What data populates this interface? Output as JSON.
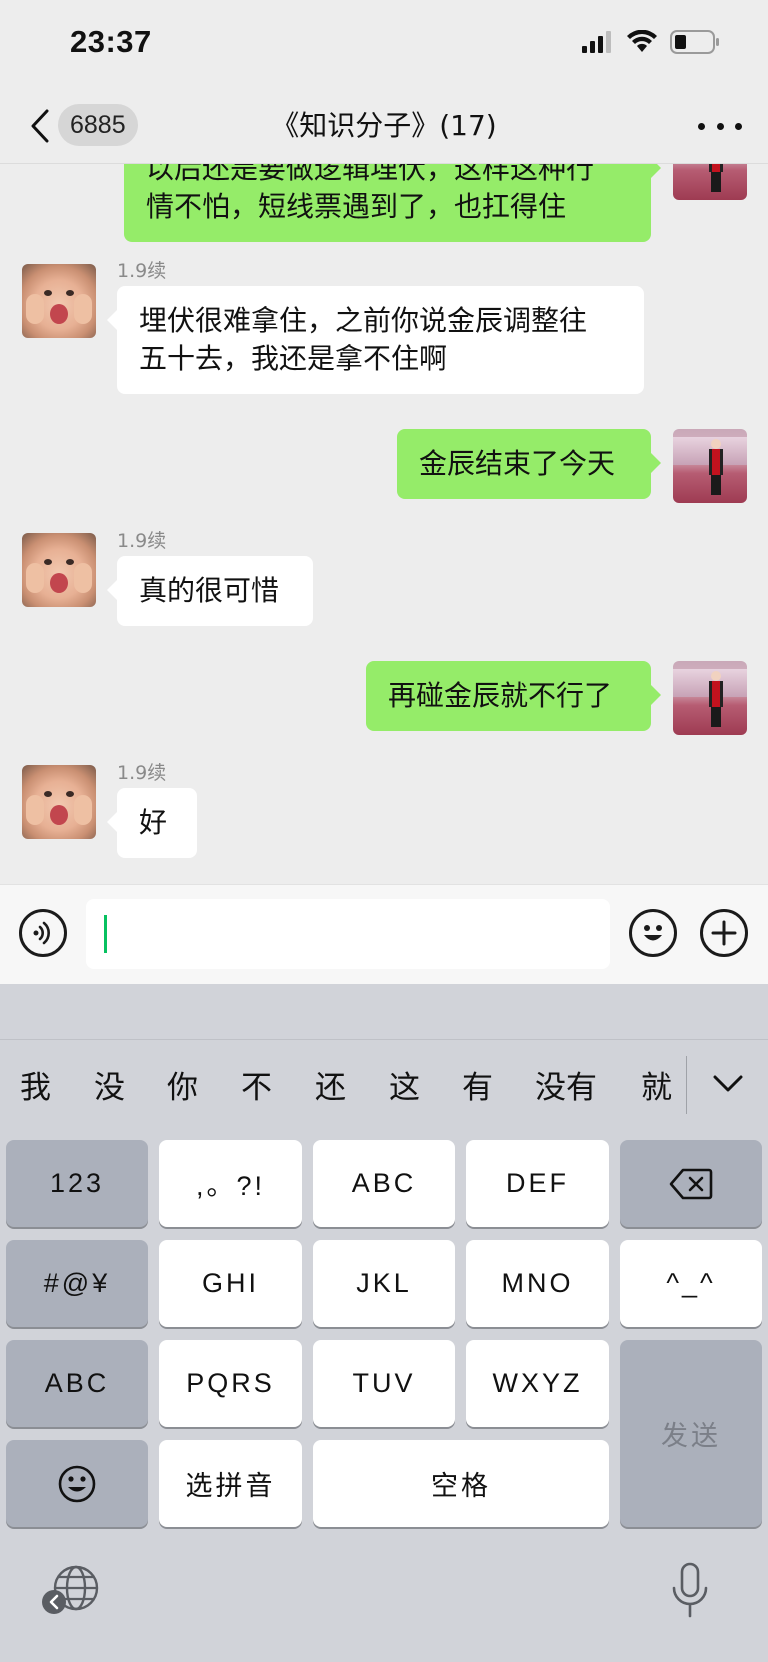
{
  "status_bar": {
    "time": "23:37",
    "icons": [
      "signal-icon",
      "wifi-icon",
      "battery-icon"
    ]
  },
  "nav": {
    "unread_count": "6885",
    "title": "《知识分子》(17)"
  },
  "messages": [
    {
      "direction": "out",
      "text_lines": [
        "以后还是要做逻辑埋伏，这样这种行",
        "情不怕，短线票遇到了，也扛得住"
      ]
    },
    {
      "direction": "in",
      "sender": "1.9续",
      "text_lines": [
        "埋伏很难拿住，之前你说金辰调整往",
        "五十去，我还是拿不住啊"
      ]
    },
    {
      "direction": "out",
      "text_lines": [
        "金辰结束了今天"
      ]
    },
    {
      "direction": "in",
      "sender": "1.9续",
      "text_lines": [
        "真的很可惜"
      ]
    },
    {
      "direction": "out",
      "text_lines": [
        "再碰金辰就不行了"
      ]
    },
    {
      "direction": "in",
      "sender": "1.9续",
      "text_lines": [
        "好"
      ]
    }
  ],
  "input": {
    "value": ""
  },
  "keyboard": {
    "candidates": [
      "我",
      "没",
      "你",
      "不",
      "还",
      "这",
      "有",
      "没有",
      "就"
    ],
    "keys": {
      "num": "123",
      "punct": ",。?!",
      "abc": "ABC",
      "def": "DEF",
      "symbols": "#@¥",
      "ghi": "GHI",
      "jkl": "JKL",
      "mno": "MNO",
      "emoticon": "^_^",
      "abc_mode": "ABC",
      "pqrs": "PQRS",
      "tuv": "TUV",
      "wxyz": "WXYZ",
      "send": "发送",
      "pinyin": "选拼音",
      "space": "空格"
    }
  },
  "colors": {
    "outgoing_bubble": "#95ec69",
    "incoming_bubble": "#ffffff",
    "caret": "#07c160",
    "chat_bg": "#ededed",
    "keyboard_bg": "#d1d3d9"
  }
}
